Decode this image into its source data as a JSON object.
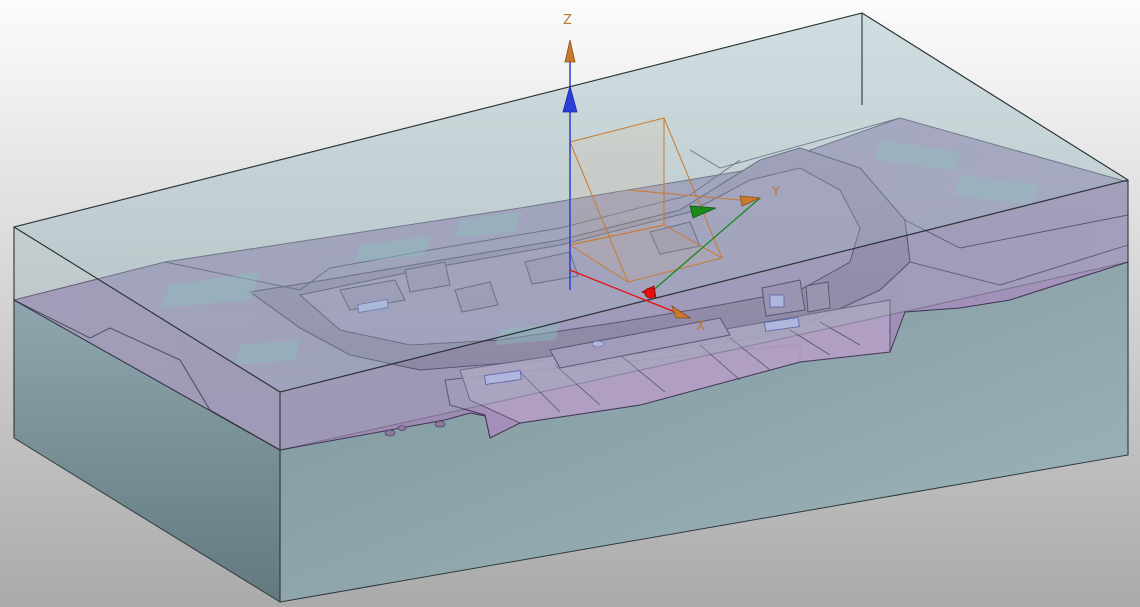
{
  "viewport": {
    "background_top": "#fcfcfc",
    "background_bottom": "#aaaaaa"
  },
  "triad": {
    "axes": [
      {
        "name": "x",
        "label": "X",
        "color": "#e81010"
      },
      {
        "name": "y",
        "label": "Y",
        "color": "#1a8a1a"
      },
      {
        "name": "z",
        "label": "Z",
        "color": "#2a3ed8"
      }
    ],
    "drag_handle_color": "#c87a2e",
    "label_color": "#b87a2e"
  },
  "model": {
    "block_color": "#a8c4cc",
    "part_color": "#a890bc",
    "part_highlight_color": "#80c0b8"
  }
}
